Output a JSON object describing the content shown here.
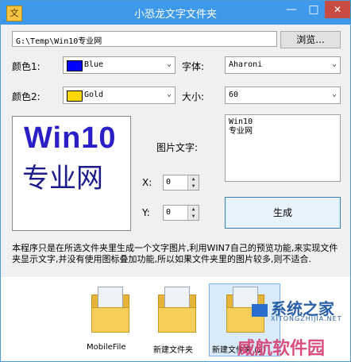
{
  "window": {
    "title": "小恐龙文字文件夹",
    "icon_glyph": "文",
    "controls": {
      "minimize": "—",
      "maximize": "□",
      "close": "✕"
    }
  },
  "path": {
    "value": "G:\\Temp\\Win10专业网",
    "browse_label": "浏览..."
  },
  "color1": {
    "label": "颜色1:",
    "value": "Blue",
    "swatch": "#0000ff"
  },
  "color2": {
    "label": "颜色2:",
    "value": "Gold",
    "swatch": "#ffd700"
  },
  "font": {
    "label": "字体:",
    "value": "Aharoni"
  },
  "size": {
    "label": "大小:",
    "value": "60"
  },
  "preview": {
    "line1": "Win10",
    "line2": "专业网"
  },
  "image_text": {
    "label": "图片文字:",
    "value": "Win10\n专业网"
  },
  "x": {
    "label": "X:",
    "value": "0"
  },
  "y": {
    "label": "Y:",
    "value": "0"
  },
  "generate_label": "生成",
  "description": "本程序只是在所选文件夹里生成一个文字图片,利用WIN7自己的预览功能,来实现文件夹显示文字,并没有使用图标叠加功能,所以如果文件夹里的图片较多,则不适合.",
  "folders": [
    {
      "name": "MobileFile"
    },
    {
      "name": "新建文件夹"
    },
    {
      "name": "新建文件夹 (2)"
    }
  ],
  "watermarks": {
    "site1": "系统之家",
    "site1_url": "XITONGZHIJIA.NET",
    "site2": "威航软件园"
  }
}
